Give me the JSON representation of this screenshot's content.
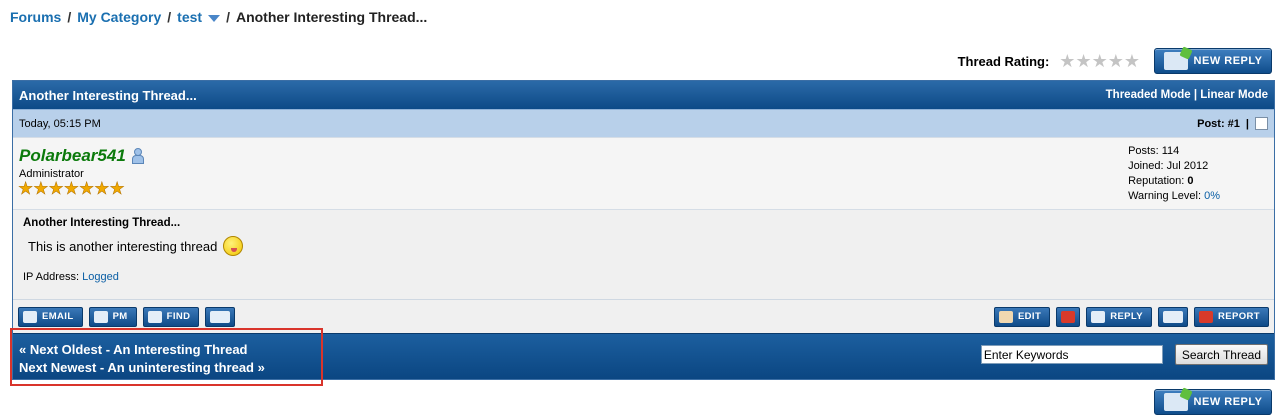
{
  "breadcrumb": {
    "forums": "Forums",
    "category": "My Category",
    "sub": "test",
    "current": "Another Interesting Thread..."
  },
  "rating": {
    "label": "Thread Rating:",
    "value": 0,
    "max": 5
  },
  "buttons": {
    "new_reply": "NEW REPLY"
  },
  "thread": {
    "title": "Another Interesting Thread...",
    "modes": {
      "threaded": "Threaded Mode",
      "separator": "|",
      "linear": "Linear Mode"
    }
  },
  "post": {
    "date": "Today, 05:15 PM",
    "number": "Post: #1",
    "num_sep": "|",
    "author": "Polarbear541",
    "user_title": "Administrator",
    "user_stars": 7,
    "stats": {
      "posts_label": "Posts:",
      "posts": "114",
      "joined_label": "Joined:",
      "joined": "Jul 2012",
      "reputation_label": "Reputation:",
      "reputation": "0",
      "warning_label": "Warning Level:",
      "warning": "0%"
    },
    "subject": "Another Interesting Thread...",
    "message": "This is another interesting thread",
    "ip_label": "IP Address:",
    "ip_value": "Logged"
  },
  "post_buttons_left": {
    "email": "EMAIL",
    "pm": "PM",
    "find": "FIND"
  },
  "post_buttons_right": {
    "edit": "EDIT",
    "reply": "REPLY",
    "report": "REPORT"
  },
  "nav": {
    "next_oldest": "« Next Oldest - An Interesting Thread",
    "next_newest": "Next Newest - An uninteresting thread »"
  },
  "search": {
    "value": "Enter Keywords",
    "button": "Search Thread"
  },
  "colors": {
    "header_blue": "#0d4a87",
    "post_head_blue": "#b8d0ea",
    "username_green": "#0b7a0b",
    "highlight_red": "#d9342b"
  }
}
